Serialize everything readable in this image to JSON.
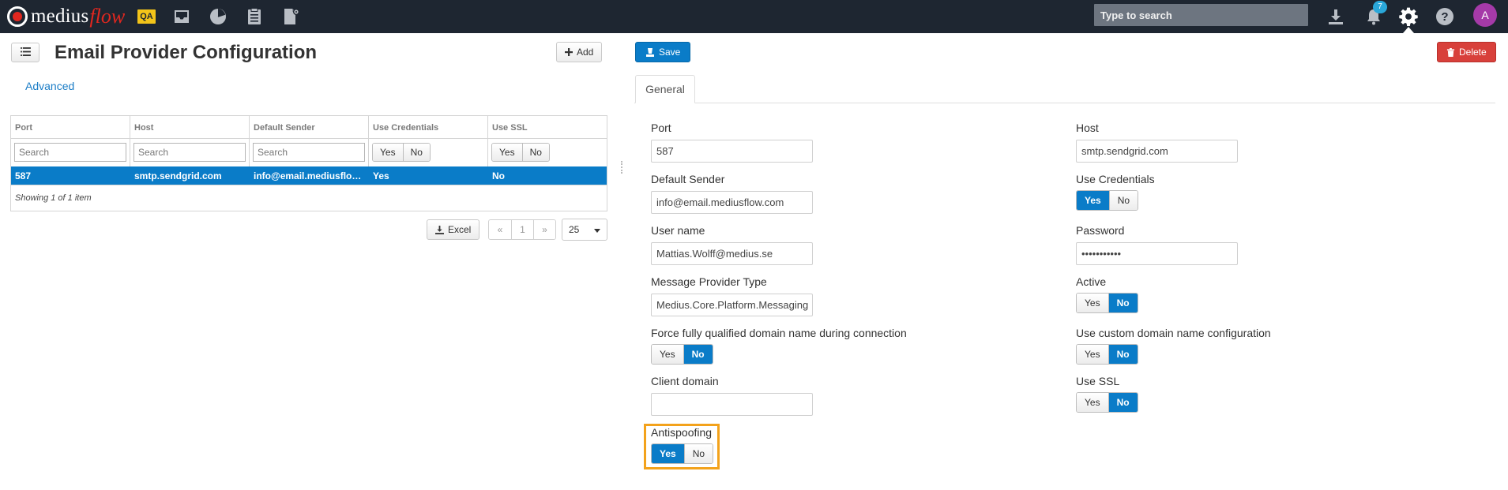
{
  "topbar": {
    "logo_word1": "medius",
    "logo_word2": "flow",
    "env_badge": "QA",
    "search_placeholder": "Type to search",
    "notification_count": "7",
    "avatar_initial": "A"
  },
  "left": {
    "title": "Email Provider Configuration",
    "add_label": "Add",
    "advanced_label": "Advanced",
    "columns": [
      "Port",
      "Host",
      "Default Sender",
      "Use Credentials",
      "Use SSL"
    ],
    "filter_placeholder": "Search",
    "filter_yes": "Yes",
    "filter_no": "No",
    "rows": [
      {
        "port": "587",
        "host": "smtp.sendgrid.com",
        "sender": "info@email.mediusflow.com",
        "credentials": "Yes",
        "ssl": "No"
      }
    ],
    "footer": "Showing 1 of 1 item",
    "excel_label": "Excel",
    "pager": {
      "prev": "«",
      "page": "1",
      "next": "»"
    },
    "page_size": "25"
  },
  "right": {
    "save_label": "Save",
    "delete_label": "Delete",
    "tab_general": "General",
    "yes": "Yes",
    "no": "No",
    "fields": {
      "port_label": "Port",
      "port_value": "587",
      "host_label": "Host",
      "host_value": "smtp.sendgrid.com",
      "sender_label": "Default Sender",
      "sender_value": "info@email.mediusflow.com",
      "credentials_label": "Use Credentials",
      "username_label": "User name",
      "username_value": "Mattias.Wolff@medius.se",
      "password_label": "Password",
      "password_value": "•••••••••••",
      "provider_label": "Message Provider Type",
      "provider_value": "Medius.Core.Platform.Messaging",
      "active_label": "Active",
      "fqdn_label": "Force fully qualified domain name during connection",
      "custom_domain_label": "Use custom domain name configuration",
      "client_domain_label": "Client domain",
      "client_domain_value": "",
      "ssl_label": "Use SSL",
      "antispoofing_label": "Antispoofing"
    },
    "toggles": {
      "credentials": "Yes",
      "active": "No",
      "fqdn": "No",
      "custom_domain": "No",
      "ssl": "No",
      "antispoofing": "Yes"
    }
  },
  "colors": {
    "topbar_bg": "#1e2631",
    "primary": "#0a7cc8",
    "danger": "#d8403b",
    "highlight": "#f3a21b",
    "brand_red": "#e0271f",
    "qa_yellow": "#f3c419"
  }
}
